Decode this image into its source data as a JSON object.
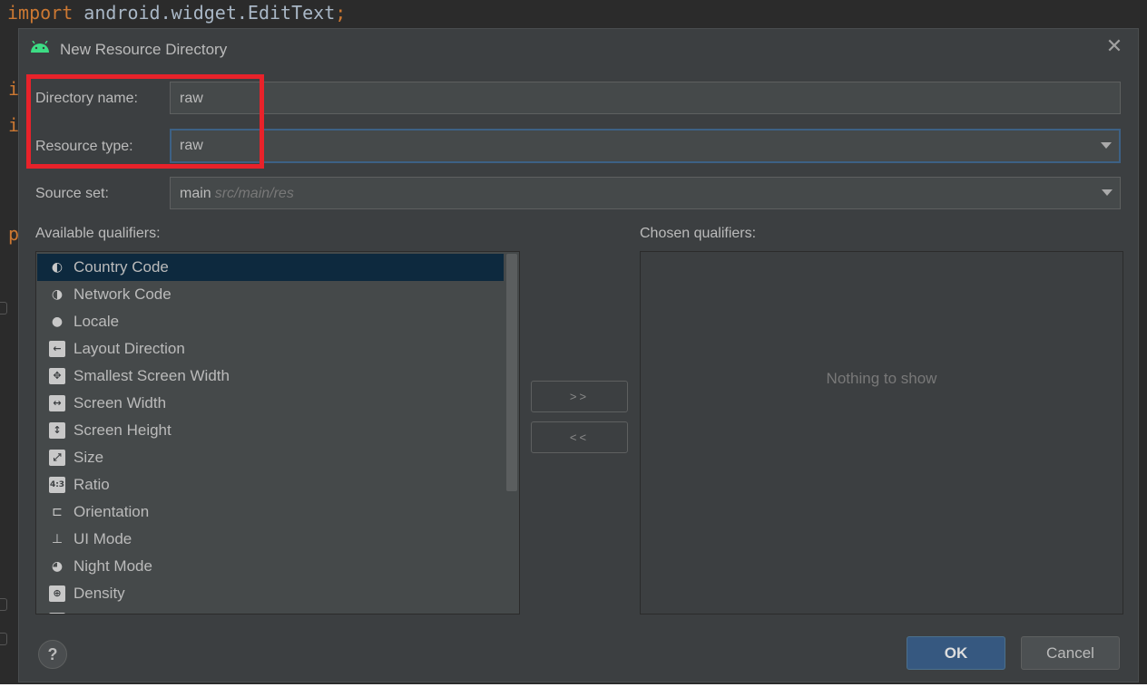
{
  "editor": {
    "import_keyword": "import",
    "import_path": " android.widget.EditText",
    "semicolon": ";"
  },
  "dialog": {
    "title": "New Resource Directory",
    "directory_name": {
      "label": "Directory name:",
      "value": "raw"
    },
    "resource_type": {
      "label": "Resource type:",
      "value": "raw"
    },
    "source_set": {
      "label": "Source set:",
      "value": "main",
      "hint": "src/main/res"
    },
    "available_label": "Available qualifiers:",
    "chosen_label": "Chosen qualifiers:",
    "qualifiers": [
      {
        "label": "Country Code",
        "icon": "country-code-icon",
        "selected": true
      },
      {
        "label": "Network Code",
        "icon": "network-code-icon"
      },
      {
        "label": "Locale",
        "icon": "locale-icon"
      },
      {
        "label": "Layout Direction",
        "icon": "layout-direction-icon"
      },
      {
        "label": "Smallest Screen Width",
        "icon": "smallest-screen-width-icon"
      },
      {
        "label": "Screen Width",
        "icon": "screen-width-icon"
      },
      {
        "label": "Screen Height",
        "icon": "screen-height-icon"
      },
      {
        "label": "Size",
        "icon": "size-icon"
      },
      {
        "label": "Ratio",
        "icon": "ratio-icon"
      },
      {
        "label": "Orientation",
        "icon": "orientation-icon"
      },
      {
        "label": "UI Mode",
        "icon": "ui-mode-icon"
      },
      {
        "label": "Night Mode",
        "icon": "night-mode-icon"
      },
      {
        "label": "Density",
        "icon": "density-icon"
      }
    ],
    "add_button": ">>",
    "remove_button": "<<",
    "empty_text": "Nothing to show",
    "help_label": "?",
    "ok_label": "OK",
    "cancel_label": "Cancel"
  },
  "colors": {
    "dialog_bg": "#3c3f41",
    "field_bg": "#45494a",
    "selection": "#0d293e",
    "focus_border": "#3d6185",
    "highlight_box": "#e8222a",
    "ok_button": "#365880",
    "android_green": "#3ddc84"
  }
}
